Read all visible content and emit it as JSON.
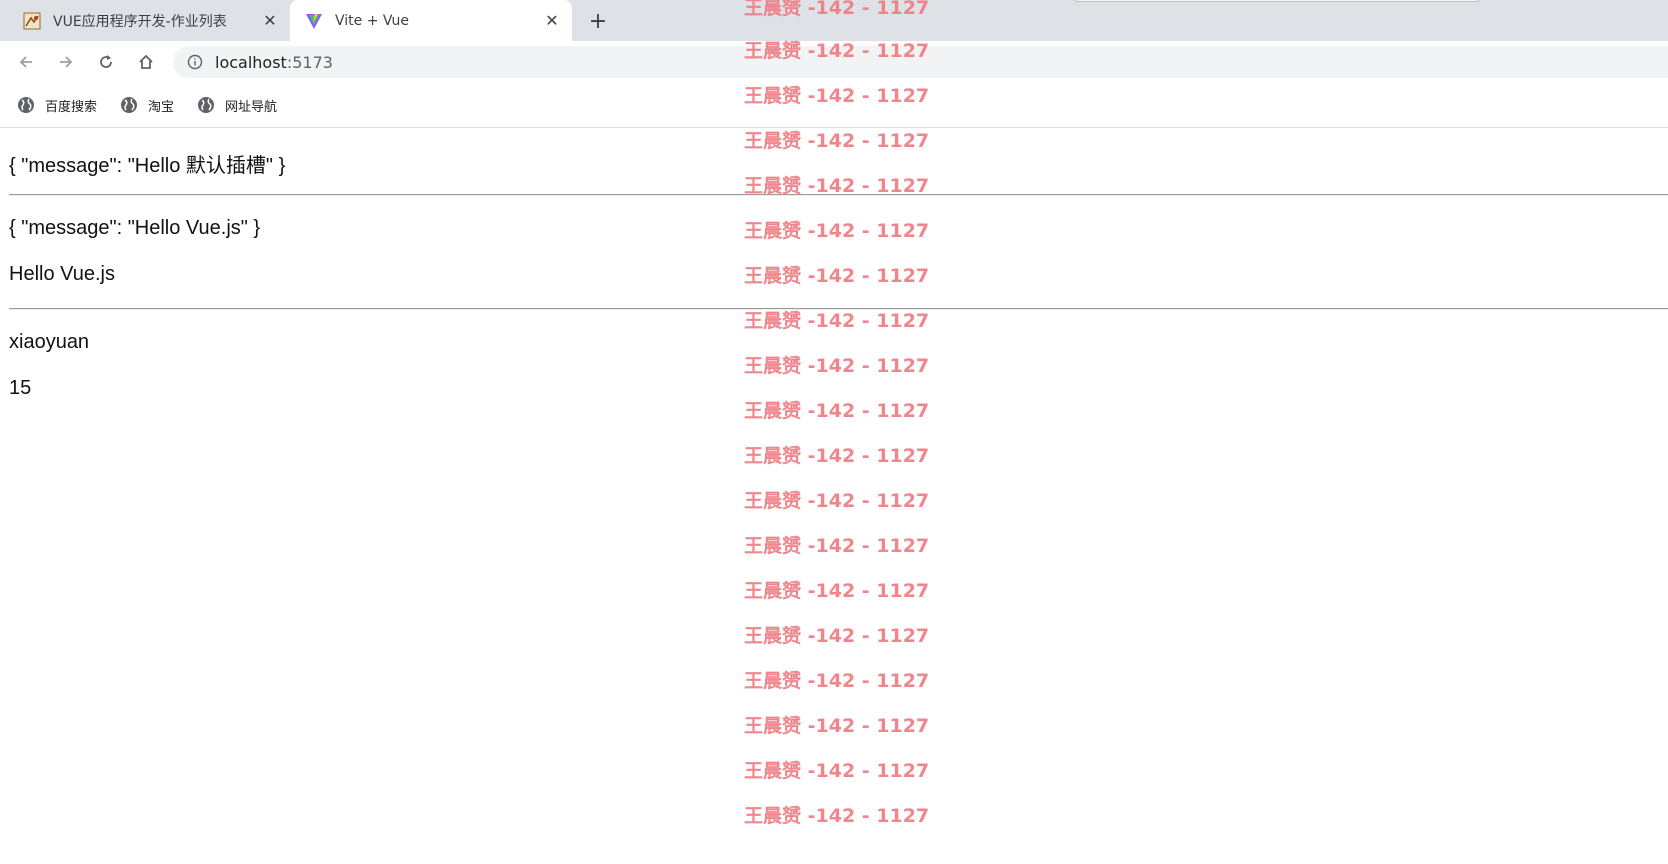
{
  "tabs": [
    {
      "title": "VUE应用程序开发-作业列表",
      "close": "✕"
    },
    {
      "title": "Vite + Vue",
      "close": "✕"
    }
  ],
  "new_tab": "+",
  "address_bar": {
    "host": "localhost",
    "port": ":5173"
  },
  "bookmarks": [
    {
      "label": "百度搜索"
    },
    {
      "label": "淘宝"
    },
    {
      "label": "网址导航"
    }
  ],
  "page": {
    "line1": "{ \"message\": \"Hello 默认插槽\" }",
    "line2": "{ \"message\": \"Hello Vue.js\" }",
    "line3": "Hello Vue.js",
    "line4": "xiaoyuan",
    "line5": "15"
  },
  "watermark": "王晨赟 -142 - 1127",
  "colors": {
    "watermark": "#ef7a80",
    "tabstrip": "#dee1e6",
    "omnibox": "#f1f3f4"
  }
}
